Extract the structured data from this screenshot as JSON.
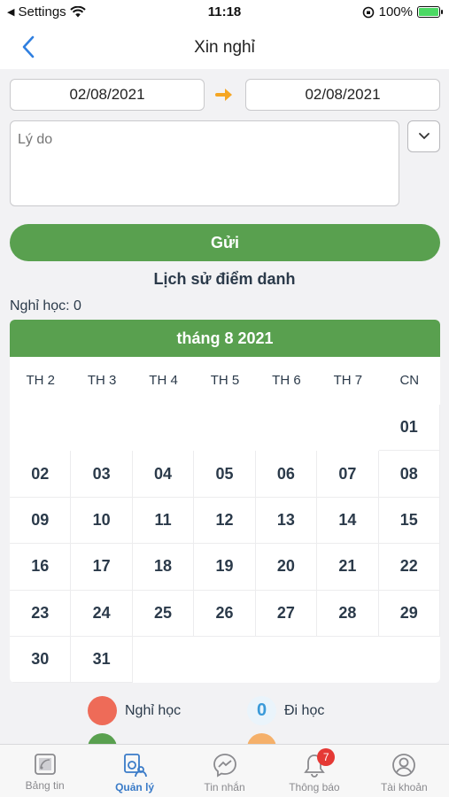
{
  "status_bar": {
    "back_app": "Settings",
    "time": "11:18",
    "battery_percent": "100%"
  },
  "nav": {
    "title": "Xin nghỉ"
  },
  "form": {
    "from_date": "02/08/2021",
    "to_date": "02/08/2021",
    "reason_placeholder": "Lý do",
    "send_label": "Gửi"
  },
  "history": {
    "title": "Lịch sử điểm danh",
    "absent_count": "Nghỉ học: 0"
  },
  "calendar": {
    "month_title": "tháng 8 2021",
    "weekdays": [
      "TH 2",
      "TH 3",
      "TH 4",
      "TH 5",
      "TH 6",
      "TH 7",
      "CN"
    ],
    "leading_empty": 6,
    "days": [
      "01",
      "02",
      "03",
      "04",
      "05",
      "06",
      "07",
      "08",
      "09",
      "10",
      "11",
      "12",
      "13",
      "14",
      "15",
      "16",
      "17",
      "18",
      "19",
      "20",
      "21",
      "22",
      "23",
      "24",
      "25",
      "26",
      "27",
      "28",
      "29",
      "30",
      "31"
    ]
  },
  "legend": {
    "absent_label": "Nghỉ học",
    "present_label": "Đi học",
    "present_count": "0",
    "absent_color": "#ee6b58",
    "present_bg": "#eaf4fb",
    "present_color": "#3a9ad9"
  },
  "tabs": [
    {
      "label": "Bảng tin",
      "icon": "newsfeed-icon"
    },
    {
      "label": "Quản lý",
      "icon": "management-icon"
    },
    {
      "label": "Tin nhắn",
      "icon": "messenger-icon"
    },
    {
      "label": "Thông báo",
      "icon": "bell-icon",
      "badge": "7"
    },
    {
      "label": "Tài khoản",
      "icon": "user-icon"
    }
  ],
  "colors": {
    "accent_green": "#59a04f",
    "active_tab": "#3a7bc8",
    "arrow_orange": "#f5a623"
  }
}
